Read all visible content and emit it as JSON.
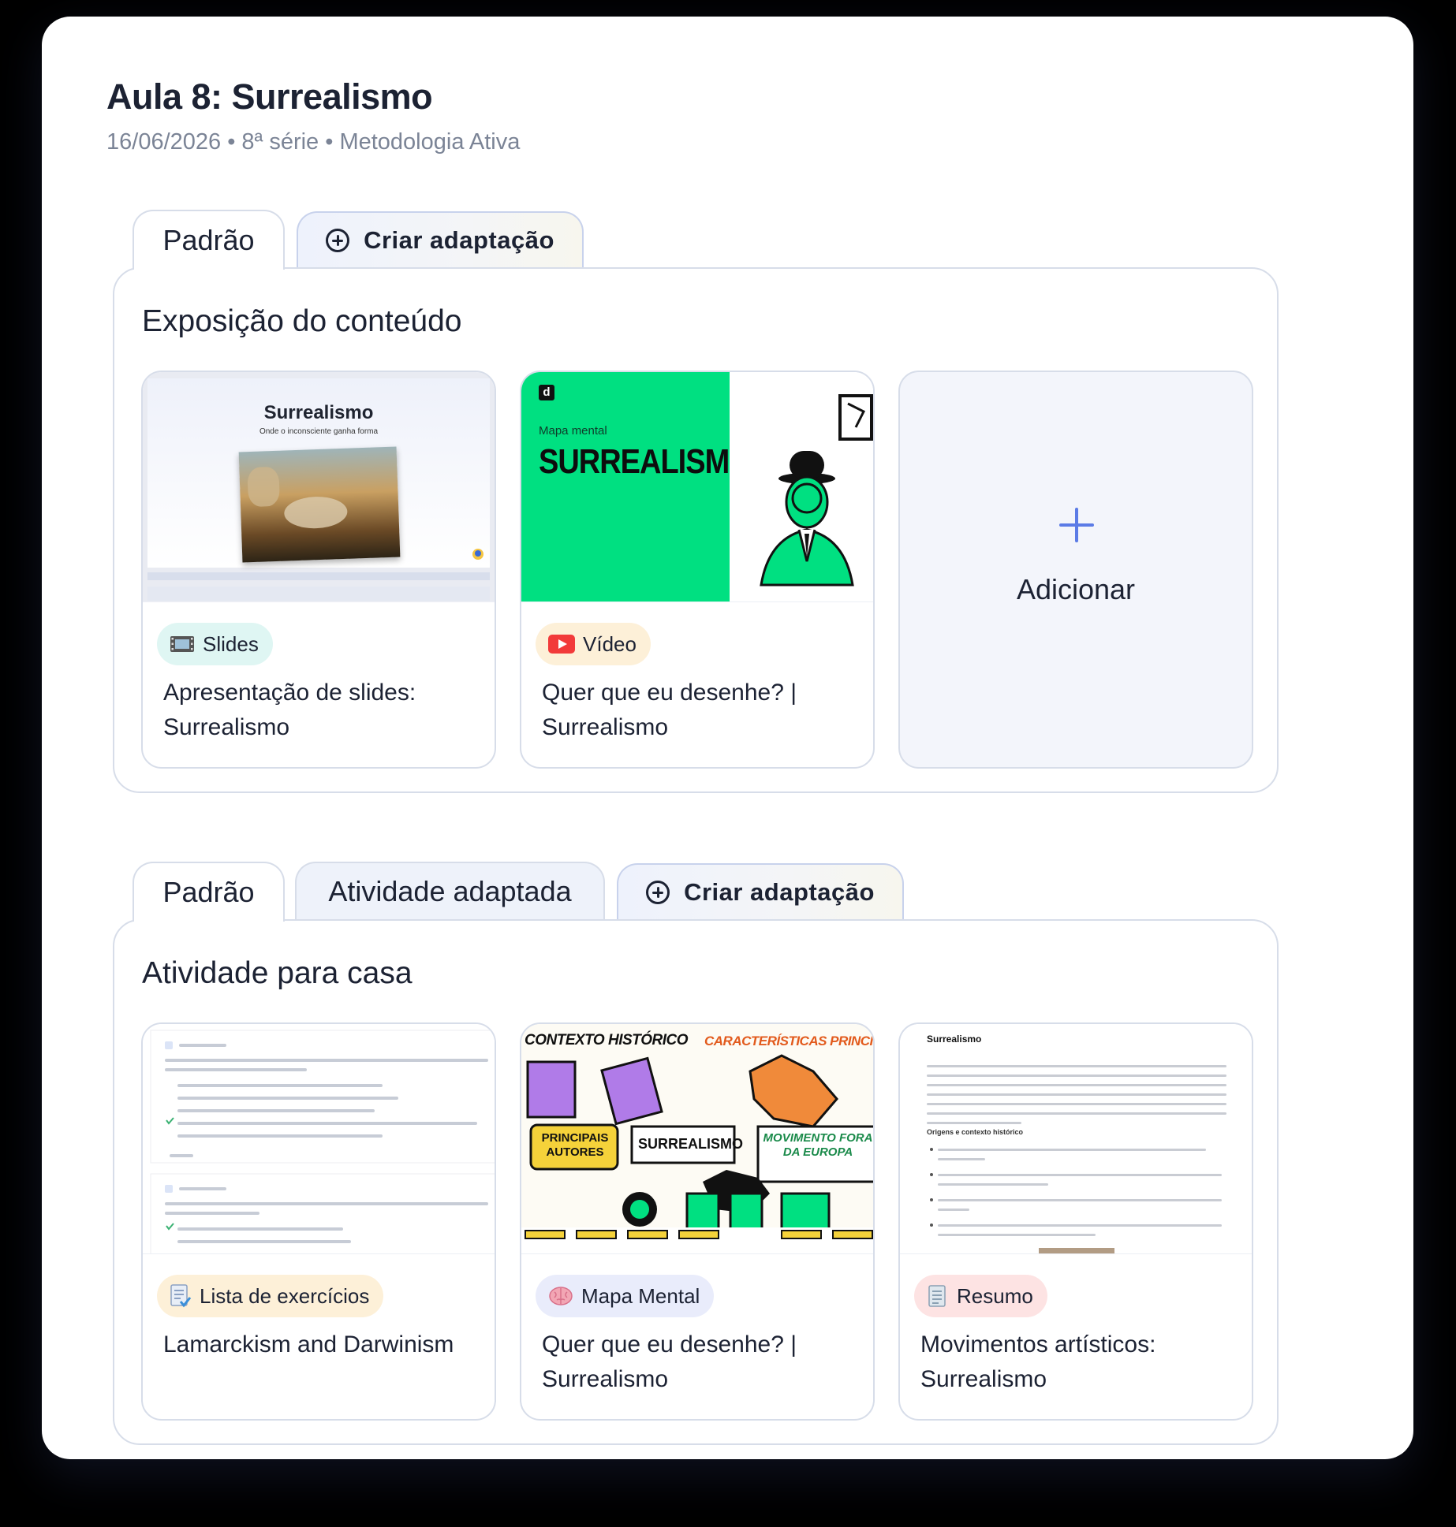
{
  "lesson": {
    "title": "Aula 8: Surrealismo",
    "meta": "16/06/2026 • 8ª série • Metodologia Ativa"
  },
  "section1": {
    "tabs": {
      "standard": "Padrão",
      "create": "Criar adaptação"
    },
    "title": "Exposição do conteúdo",
    "cards": [
      {
        "badge": "Slides",
        "badge_icon": "film-icon",
        "badge_color": "#dff6f3",
        "title": "Apresentação de slides: Surrealismo",
        "thumb": {
          "title": "Surrealismo",
          "subtitle": "Onde o inconsciente ganha forma"
        }
      },
      {
        "badge": "Vídeo",
        "badge_icon": "youtube-icon",
        "badge_color": "#fdf0d8",
        "title": "Quer que eu desenhe? | Surrealismo",
        "thumb": {
          "logo": "d",
          "small": "Mapa mental",
          "big": "SURREALISMO"
        }
      }
    ],
    "add_label": "Adicionar"
  },
  "section2": {
    "tabs": {
      "standard": "Padrão",
      "adapted": "Atividade adaptada",
      "create": "Criar adaptação"
    },
    "title": "Atividade para casa",
    "cards": [
      {
        "badge": "Lista de exercícios",
        "badge_icon": "checklist-icon",
        "badge_color": "#fdf0d8",
        "title": "Lamarckism and Darwinism"
      },
      {
        "badge": "Mapa Mental",
        "badge_icon": "brain-icon",
        "badge_color": "#e9ecfb",
        "title": "Quer que eu desenhe? | Surrealismo",
        "thumb": {
          "heading_left": "CONTEXTO HISTÓRICO",
          "heading_right": "CARACTERÍSTICAS PRINCIPAIS",
          "center": "SURREALISMO",
          "left_box": "PRINCIPAIS AUTORES",
          "right_box": "MOVIMENTO FORA DA EUROPA"
        }
      },
      {
        "badge": "Resumo",
        "badge_icon": "document-icon",
        "badge_color": "#fde3e3",
        "title": "Movimentos artísticos: Surrealismo",
        "thumb": {
          "heading": "Surrealismo",
          "subheading": "Origens e contexto histórico"
        }
      }
    ]
  },
  "colors": {
    "accent": "#5b7be6",
    "mind_green": "#00e081",
    "mind_purple": "#b07be8"
  }
}
